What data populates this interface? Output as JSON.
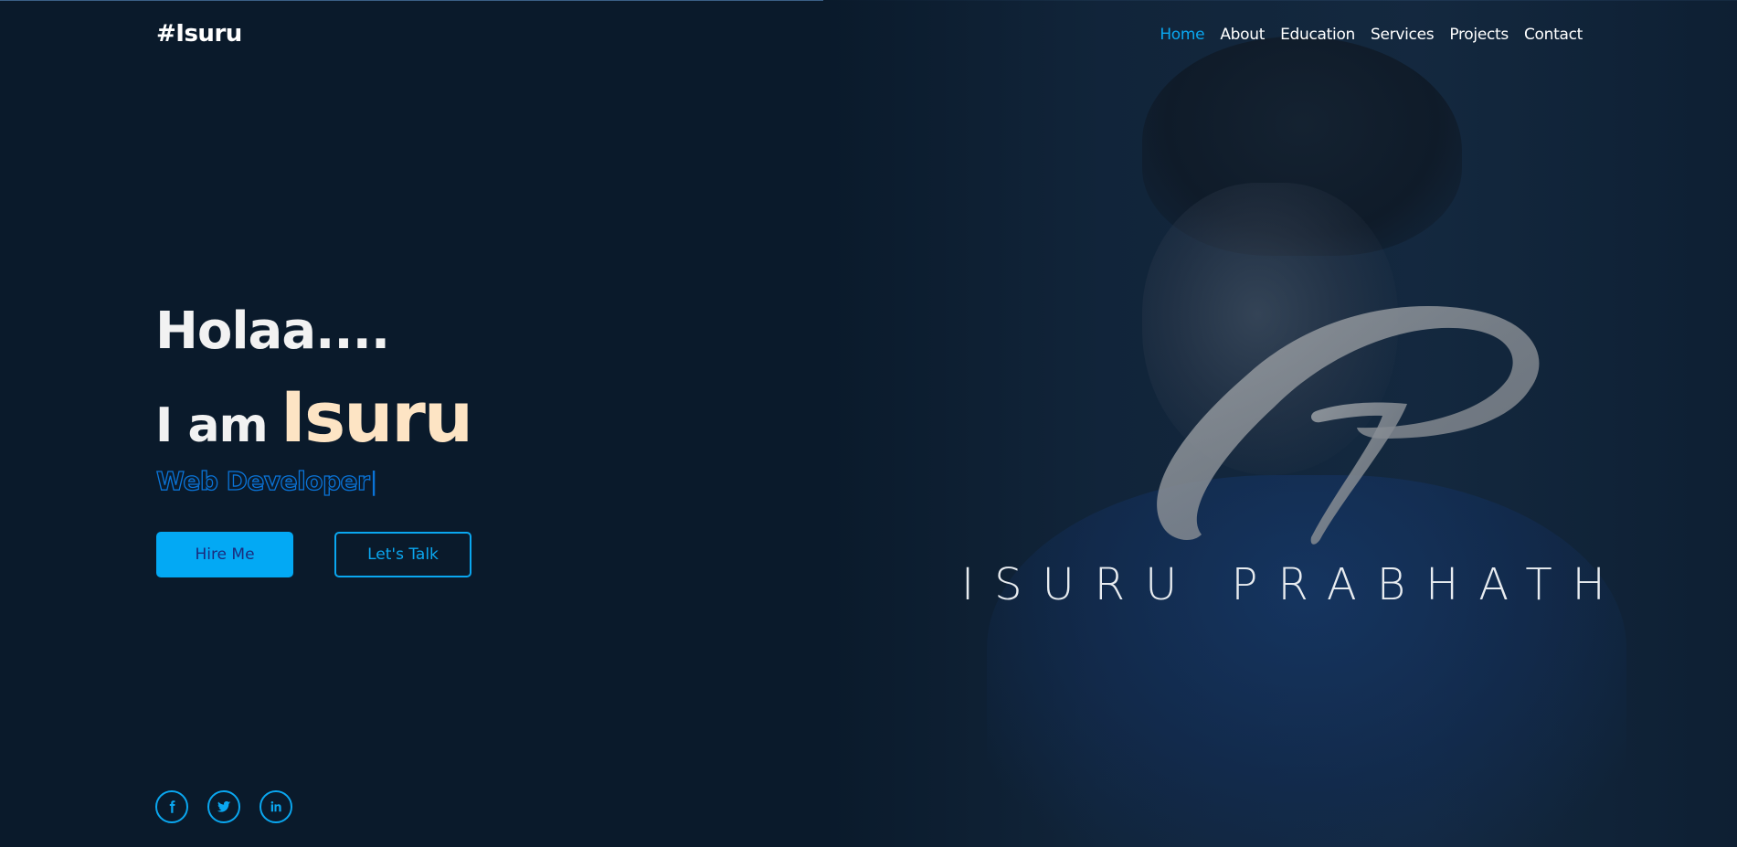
{
  "brand": {
    "logo_text": "#Isuru"
  },
  "nav": {
    "items": [
      {
        "label": "Home",
        "active": true
      },
      {
        "label": "About",
        "active": false
      },
      {
        "label": "Education",
        "active": false
      },
      {
        "label": "Services",
        "active": false
      },
      {
        "label": "Projects",
        "active": false
      },
      {
        "label": "Contact",
        "active": false
      }
    ]
  },
  "hero": {
    "greeting": "Holaa....",
    "intro_prefix": "I am",
    "intro_name": "Isuru",
    "role": "Web Developer",
    "cursor": "|",
    "hire_button": "Hire Me",
    "talk_button": "Let's Talk"
  },
  "signature": {
    "name": "ISURU PRABHATH"
  },
  "socials": [
    {
      "icon": "facebook-icon"
    },
    {
      "icon": "twitter-icon"
    },
    {
      "icon": "linkedin-icon"
    }
  ],
  "colors": {
    "background": "#0a1a2b",
    "accent": "#03a9f4",
    "name_highlight": "#fde4c4",
    "role_outline": "#0a74d8"
  }
}
